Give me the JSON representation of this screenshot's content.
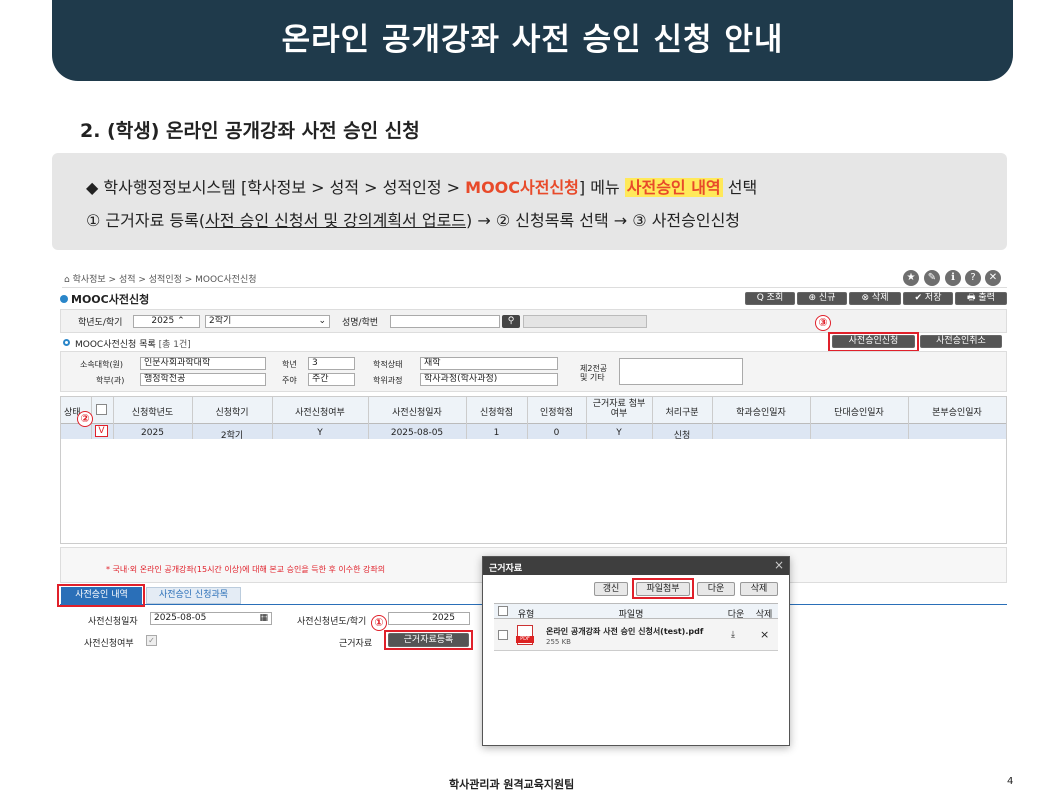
{
  "slide": {
    "title": "온라인 공개강좌 사전 승인 신청 안내",
    "subtitle": "2. (학생) 온라인 공개강좌 사전 승인 신청",
    "line1_a": "◆ 학사행정정보시스템 [학사정보 > 성적 > 성적인정 > ",
    "line1_b": "MOOC사전신청",
    "line1_c": "] 메뉴 ",
    "line1_d": "사전승인 내역",
    "line1_e": " 선택",
    "line2_a": "① 근거자료 등록(",
    "line2_b": "사전 승인 신청서 및 강의계획서 업로드",
    "line2_c": ") → ② 신청목록 선택 → ③ 사전승인신청",
    "footer": "학사관리과 원격교육지원팀",
    "page_num": "4"
  },
  "ui": {
    "breadcrumb": "⌂ 학사정보 > 성적 > 성적인정 > MOOC사전신청",
    "page_title": "MOOC사전신청",
    "top_buttons": [
      "Q 조회",
      "⊕ 신규",
      "⊗ 삭제",
      "✔ 저장",
      "🖶 출력"
    ],
    "top_icons": [
      "★",
      "✎",
      "ℹ",
      "?",
      "✕"
    ],
    "filter": {
      "year_label": "학년도/학기",
      "year": "2025",
      "term": "2학기",
      "name_label": "성명/학번",
      "name_value": ""
    },
    "list_title": "MOOC사전신청 목록",
    "list_count": "[총 1건]",
    "apply_button": "사전승인신청",
    "cancel_button": "사전승인취소",
    "info": {
      "college_label": "소속대학(원)",
      "college": "인문사회과학대학",
      "grade_label": "학년",
      "grade": "3",
      "status_label": "학적상태",
      "status": "재학",
      "dept_label": "학부(과)",
      "dept": "행정학전공",
      "dn_label": "주야",
      "dn": "주간",
      "course_label": "학위과정",
      "course": "학사과정(학사과정)",
      "major2_label": "제2전공",
      "etc_label": "및 기타"
    },
    "table": {
      "headers": [
        "상태",
        "",
        "신청학년도",
        "신청학기",
        "사전신청여부",
        "사전신청일자",
        "신청학점",
        "인정학점",
        "근거자료 첨부여부",
        "처리구분",
        "학과승인일자",
        "단대승인일자",
        "본부승인일자"
      ],
      "row": [
        "",
        "V",
        "2025",
        "2학기",
        "Y",
        "2025-08-05",
        "1",
        "0",
        "Y",
        "신청",
        "",
        "",
        ""
      ]
    },
    "notice": "* 국내·외 온라인 공개강좌(15시간 이상)에 대해 본교 승인을 득한 후 이수한 강좌의 ",
    "tabs": [
      "사전승인 내역",
      "사전승인 신청과목"
    ],
    "detail": {
      "date_label": "사전신청일자",
      "date": "2025-08-05",
      "term_label": "사전신청년도/학기",
      "year": "2025",
      "flag_label": "사전신청여부",
      "evidence_label": "근거자료",
      "evidence_button": "근거자료등록"
    },
    "dialog": {
      "title": "근거자료",
      "buttons": [
        "갱신",
        "파일첨부",
        "다운",
        "삭제"
      ],
      "headers": [
        "유형",
        "파일명",
        "다운",
        "삭제"
      ],
      "file_name": "온라인 공개강좌 사전 승인 신청서(test).pdf",
      "file_size": "255 KB",
      "file_type": "PDF"
    },
    "markers": [
      "①",
      "②",
      "③"
    ]
  }
}
